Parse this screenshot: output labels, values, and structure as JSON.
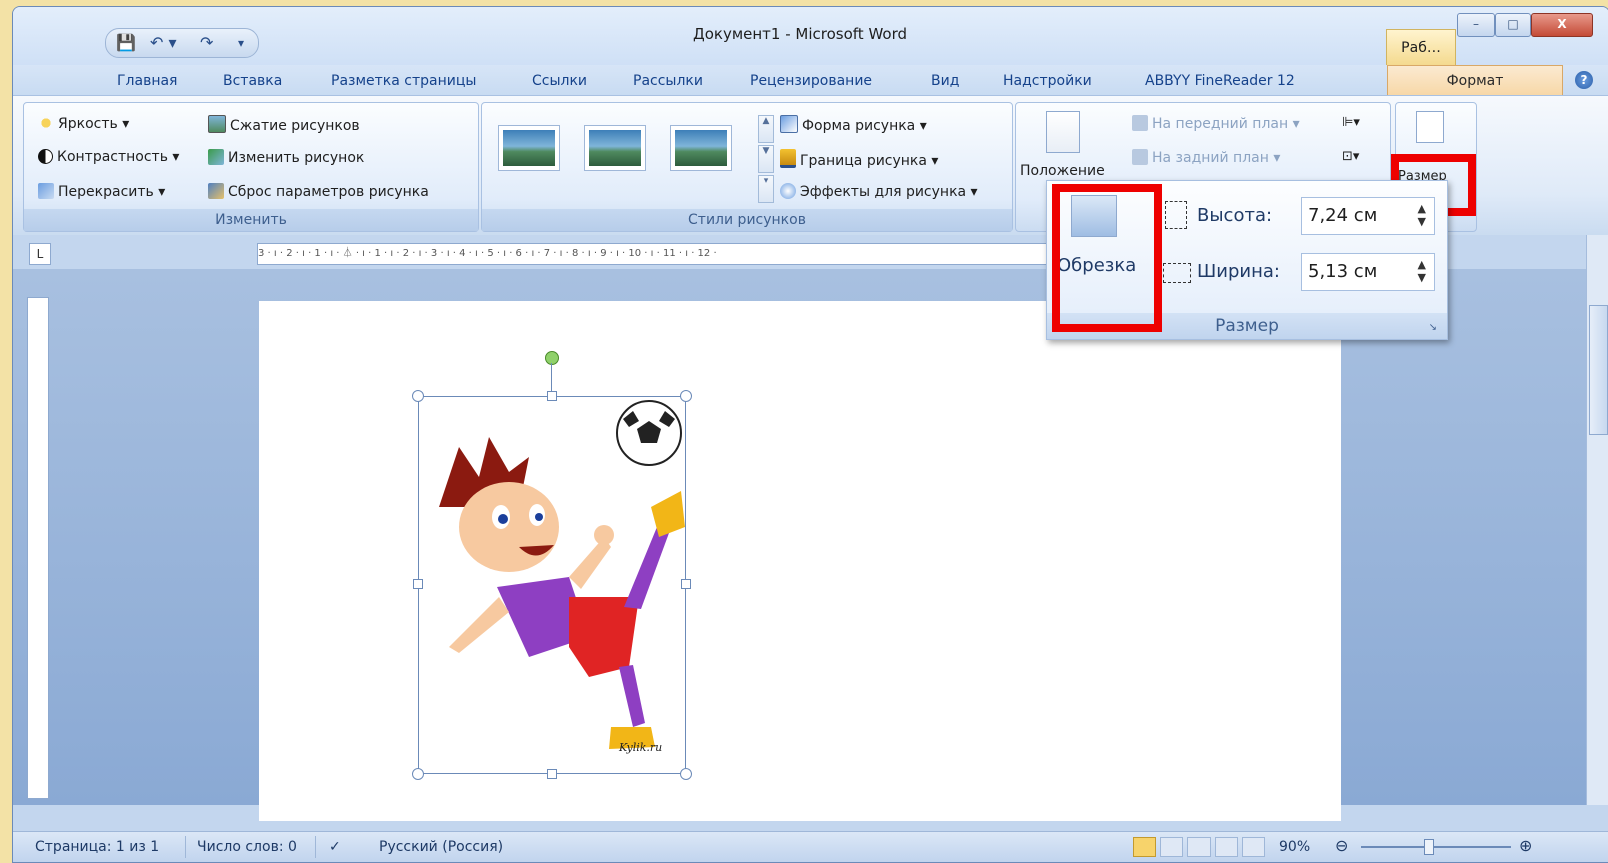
{
  "window": {
    "title": "Документ1 - Microsoft Word",
    "context_tab": "Раб…",
    "btn_min": "–",
    "btn_max": "□",
    "btn_close": "X"
  },
  "quick_access": {
    "save": "💾",
    "undo": "↶ ▾",
    "redo": "↷",
    "customize": "▾"
  },
  "tabs": [
    "Главная",
    "Вставка",
    "Разметка страницы",
    "Ссылки",
    "Рассылки",
    "Рецензирование",
    "Вид",
    "Надстройки",
    "ABBYY FineReader 12",
    "Формат"
  ],
  "help": "?",
  "ribbon": {
    "adjust": {
      "label": "Изменить",
      "brightness": "Яркость ▾",
      "contrast": "Контрастность ▾",
      "recolor": "Перекрасить ▾",
      "compress": "Сжатие рисунков",
      "change": "Изменить рисунок",
      "reset": "Сброс параметров рисунка"
    },
    "styles": {
      "label": "Стили рисунков",
      "shape": "Форма рисунка ▾",
      "border": "Граница рисунка ▾",
      "effects": "Эффекты для рисунка ▾"
    },
    "arrange": {
      "position": "Положение",
      "front": "На передний план ▾",
      "back": "На задний план ▾"
    },
    "size_btn": "Размер"
  },
  "ruler": {
    "marks": "3 · ı · 2 · ı · 1 · ı · ⏃ · ı · 1 · ı · 2 · ı · 3 · ı · 4 · ı · 5 · ı · 6 · ı · 7 · ı · 8 · ı · 9 · ı · 10 · ı · 11 · ı · 12 ·",
    "tab_selector": "L"
  },
  "size_popup": {
    "crop": "Обрезка",
    "height_label": "Высота:",
    "height_value": "7,24 см",
    "width_label": "Ширина:",
    "width_value": "5,13 см",
    "group_label": "Размер"
  },
  "picture": {
    "watermark": "Kylik.ru"
  },
  "status": {
    "page": "Страница: 1 из 1",
    "words": "Число слов: 0",
    "lang": "Русский (Россия)",
    "zoom": "90%",
    "zoom_level": 0.9
  },
  "colors": {
    "highlight": "#ee0000",
    "ribbon_accent": "#15428b"
  }
}
